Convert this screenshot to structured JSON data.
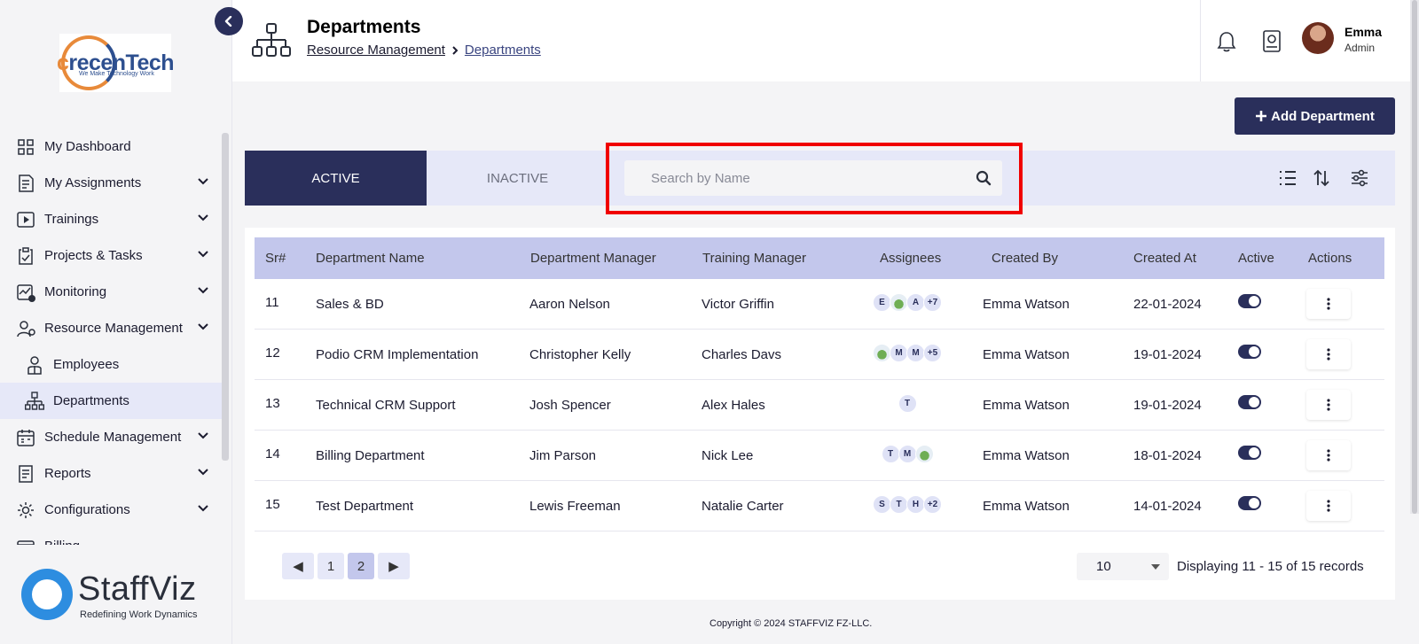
{
  "brand": {
    "logo_text_c": "c",
    "logo_text_rest": "recenTech",
    "logo_tagline": "We Make Technology Work",
    "product_name": "StaffViz",
    "product_tagline": "Redefining Work Dynamics"
  },
  "sidebar": {
    "items": [
      {
        "label": "My Dashboard",
        "icon": "dashboard-icon",
        "has_chevron": false
      },
      {
        "label": "My Assignments",
        "icon": "assignments-icon",
        "has_chevron": true
      },
      {
        "label": "Trainings",
        "icon": "play-icon",
        "has_chevron": true
      },
      {
        "label": "Projects & Tasks",
        "icon": "clipboard-icon",
        "has_chevron": true
      },
      {
        "label": "Monitoring",
        "icon": "monitoring-icon",
        "has_chevron": true
      },
      {
        "label": "Resource Management",
        "icon": "resource-icon",
        "has_chevron": true
      },
      {
        "label": "Employees",
        "icon": "employee-icon",
        "sub": true
      },
      {
        "label": "Departments",
        "icon": "org-chart-icon",
        "sub": true,
        "active": true
      },
      {
        "label": "Schedule Management",
        "icon": "calendar-icon",
        "has_chevron": true
      },
      {
        "label": "Reports",
        "icon": "reports-icon",
        "has_chevron": true
      },
      {
        "label": "Configurations",
        "icon": "gear-icon",
        "has_chevron": true
      },
      {
        "label": "Billing",
        "icon": "billing-icon",
        "has_chevron": false
      }
    ]
  },
  "header": {
    "title": "Departments",
    "breadcrumb": [
      "Resource Management",
      "Departments"
    ],
    "user_name": "Emma",
    "user_role": "Admin"
  },
  "main": {
    "add_button": "Add Department",
    "tab_active": "ACTIVE",
    "tab_inactive": "INACTIVE",
    "search_placeholder": "Search by Name",
    "columns": [
      "Sr#",
      "Department Name",
      "Department Manager",
      "Training Manager",
      "Assignees",
      "Created By",
      "Created At",
      "Active",
      "Actions"
    ],
    "rows": [
      {
        "sr": "11",
        "name": "Sales & BD",
        "manager": "Aaron Nelson",
        "training": "Victor Griffin",
        "assignees": [
          "E",
          "img",
          "A",
          "+7"
        ],
        "created_by": "Emma Watson",
        "created_at": "22-01-2024",
        "active": true
      },
      {
        "sr": "12",
        "name": "Podio CRM Implementation",
        "manager": "Christopher Kelly",
        "training": "Charles Davs",
        "assignees": [
          "img",
          "M",
          "M",
          "+5"
        ],
        "created_by": "Emma Watson",
        "created_at": "19-01-2024",
        "active": true
      },
      {
        "sr": "13",
        "name": "Technical CRM Support",
        "manager": "Josh Spencer",
        "training": "Alex Hales",
        "assignees": [
          "T"
        ],
        "created_by": "Emma Watson",
        "created_at": "19-01-2024",
        "active": true
      },
      {
        "sr": "14",
        "name": "Billing Department",
        "manager": "Jim Parson",
        "training": "Nick Lee",
        "assignees": [
          "T",
          "M",
          "img"
        ],
        "created_by": "Emma Watson",
        "created_at": "18-01-2024",
        "active": true
      },
      {
        "sr": "15",
        "name": "Test Department",
        "manager": "Lewis Freeman",
        "training": "Natalie Carter",
        "assignees": [
          "S",
          "T",
          "H",
          "+2"
        ],
        "created_by": "Emma Watson",
        "created_at": "14-01-2024",
        "active": true
      }
    ],
    "pagination": {
      "prev": "◀",
      "pages": [
        "1",
        "2"
      ],
      "current": "2",
      "next": "▶",
      "page_size": "10",
      "records_text": "Displaying 11 - 15 of 15 records"
    }
  },
  "footer": {
    "copyright": "Copyright © 2024 STAFFVIZ FZ-LLC."
  },
  "colors": {
    "primary": "#2a2f5b",
    "header_row": "#c3c7ec",
    "toolbar": "#e6e8f8",
    "highlight": "#f00000"
  }
}
